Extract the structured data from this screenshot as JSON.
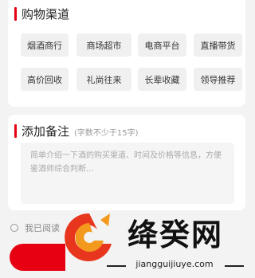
{
  "channels": {
    "title": "购物渠道",
    "options": [
      "烟酒商行",
      "商场超市",
      "电商平台",
      "直播带货",
      "高价回收",
      "礼尚往来",
      "长辈收藏",
      "领导推荐"
    ]
  },
  "remark": {
    "title": "添加备注",
    "hint": "(字数不少于15字)",
    "placeholder": "简单介绍一下酒的购买渠道、时间及价格等信息，方便鉴酒师综合判断..."
  },
  "agreement": {
    "text": "我已阅读"
  },
  "watermark": {
    "brand": "绛癸网",
    "url": "jiangguijiuye.com"
  },
  "colors": {
    "accent": "#e60012"
  }
}
